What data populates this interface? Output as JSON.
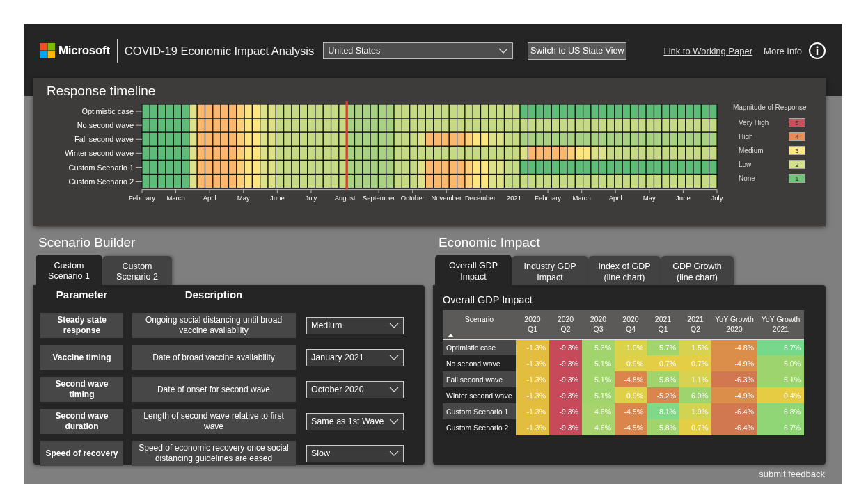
{
  "header": {
    "brand": "Microsoft",
    "title": "COVID-19 Economic Impact Analysis",
    "country": "United States",
    "state_button": "Switch to US State View",
    "paper_link": "Link to Working Paper",
    "more_info": "More Info"
  },
  "timeline": {
    "title": "Response timeline",
    "rows": [
      {
        "label": "Optimistic case",
        "cells_before_marker": [
          {
            "color": "#5fbb78"
          },
          {
            "color": "#5fbb78"
          },
          {
            "color": "#5fbb78"
          },
          {
            "color": "#5fbb78"
          },
          {
            "color": "#5fbb78"
          },
          {
            "color": "#5fbb78"
          },
          {
            "color": "#dde18a"
          },
          {
            "color": "#f9b86e"
          },
          {
            "color": "#f9b86e"
          },
          {
            "color": "#f9b86e"
          },
          {
            "color": "#f9b86e"
          },
          {
            "color": "#f9b86e"
          },
          {
            "color": "#fccf78"
          },
          {
            "color": "#fde57f"
          },
          {
            "color": "#fde57f"
          },
          {
            "color": "#dde18a"
          },
          {
            "color": "#dde18a"
          },
          {
            "color": "#c6da86"
          },
          {
            "color": "#c6da86"
          },
          {
            "color": "#c6da86"
          },
          {
            "color": "#c6da86"
          },
          {
            "color": "#c6da86"
          },
          {
            "color": "#c6da86"
          },
          {
            "color": "#c6da86"
          },
          {
            "color": "#c6da86"
          },
          {
            "color": "#c6da86"
          }
        ],
        "cells_after_marker": [
          {
            "color": "#a9d183"
          },
          {
            "color": "#a9d183"
          },
          {
            "color": "#a9d183"
          },
          {
            "color": "#a9d183"
          },
          {
            "color": "#a9d183"
          },
          {
            "color": "#a9d183"
          },
          {
            "color": "#c6da86"
          },
          {
            "color": "#c6da86"
          },
          {
            "color": "#c6da86"
          },
          {
            "color": "#c6da86"
          },
          {
            "color": "#c6da86"
          },
          {
            "color": "#c6da86"
          },
          {
            "color": "#c6da86"
          },
          {
            "color": "#c6da86"
          },
          {
            "color": "#c6da86"
          },
          {
            "color": "#c6da86"
          },
          {
            "color": "#c6da86"
          },
          {
            "color": "#c6da86"
          },
          {
            "color": "#c6da86"
          },
          {
            "color": "#c6da86"
          },
          {
            "color": "#c6da86"
          },
          {
            "color": "#c6da86"
          },
          {
            "color": "#5fbb78"
          },
          {
            "color": "#5fbb78"
          },
          {
            "color": "#5fbb78"
          },
          {
            "color": "#5fbb78"
          },
          {
            "color": "#5fbb78"
          },
          {
            "color": "#5fbb78"
          },
          {
            "color": "#5fbb78"
          },
          {
            "color": "#5fbb78"
          },
          {
            "color": "#5fbb78"
          },
          {
            "color": "#5fbb78"
          },
          {
            "color": "#5fbb78"
          },
          {
            "color": "#5fbb78"
          },
          {
            "color": "#5fbb78"
          },
          {
            "color": "#5fbb78"
          },
          {
            "color": "#5fbb78"
          },
          {
            "color": "#5fbb78"
          },
          {
            "color": "#5fbb78"
          },
          {
            "color": "#5fbb78"
          },
          {
            "color": "#5fbb78"
          },
          {
            "color": "#5fbb78"
          },
          {
            "color": "#5fbb78"
          },
          {
            "color": "#5fbb78"
          },
          {
            "color": "#5fbb78"
          },
          {
            "color": "#5fbb78"
          },
          {
            "color": "#5fbb78"
          }
        ]
      },
      {
        "label": "No second wave",
        "cells_before_marker": [
          {
            "color": "#5fbb78"
          },
          {
            "color": "#5fbb78"
          },
          {
            "color": "#5fbb78"
          },
          {
            "color": "#5fbb78"
          },
          {
            "color": "#5fbb78"
          },
          {
            "color": "#5fbb78"
          },
          {
            "color": "#dde18a"
          },
          {
            "color": "#f9b86e"
          },
          {
            "color": "#f9b86e"
          },
          {
            "color": "#f9b86e"
          },
          {
            "color": "#f9b86e"
          },
          {
            "color": "#f9b86e"
          },
          {
            "color": "#fccf78"
          },
          {
            "color": "#fde57f"
          },
          {
            "color": "#fde57f"
          },
          {
            "color": "#dde18a"
          },
          {
            "color": "#dde18a"
          },
          {
            "color": "#c6da86"
          },
          {
            "color": "#c6da86"
          },
          {
            "color": "#c6da86"
          },
          {
            "color": "#c6da86"
          },
          {
            "color": "#c6da86"
          },
          {
            "color": "#c6da86"
          },
          {
            "color": "#c6da86"
          },
          {
            "color": "#c6da86"
          },
          {
            "color": "#c6da86"
          }
        ],
        "cells_after_marker": [
          {
            "color": "#a9d183"
          },
          {
            "color": "#a9d183"
          },
          {
            "color": "#a9d183"
          },
          {
            "color": "#a9d183"
          },
          {
            "color": "#a9d183"
          },
          {
            "color": "#a9d183"
          },
          {
            "color": "#c6da86"
          },
          {
            "color": "#c6da86"
          },
          {
            "color": "#c6da86"
          },
          {
            "color": "#c6da86"
          },
          {
            "color": "#c6da86"
          },
          {
            "color": "#c6da86"
          },
          {
            "color": "#c6da86"
          },
          {
            "color": "#c6da86"
          },
          {
            "color": "#c6da86"
          },
          {
            "color": "#c6da86"
          },
          {
            "color": "#c6da86"
          },
          {
            "color": "#c6da86"
          },
          {
            "color": "#c6da86"
          },
          {
            "color": "#c6da86"
          },
          {
            "color": "#c6da86"
          },
          {
            "color": "#c6da86"
          },
          {
            "color": "#c6da86"
          },
          {
            "color": "#c6da86"
          },
          {
            "color": "#c6da86"
          },
          {
            "color": "#c6da86"
          },
          {
            "color": "#c6da86"
          },
          {
            "color": "#c6da86"
          },
          {
            "color": "#c6da86"
          },
          {
            "color": "#c6da86"
          },
          {
            "color": "#c6da86"
          },
          {
            "color": "#c6da86"
          },
          {
            "color": "#c6da86"
          },
          {
            "color": "#c6da86"
          },
          {
            "color": "#c6da86"
          },
          {
            "color": "#c6da86"
          },
          {
            "color": "#c6da86"
          },
          {
            "color": "#c6da86"
          },
          {
            "color": "#c6da86"
          },
          {
            "color": "#c6da86"
          },
          {
            "color": "#c6da86"
          },
          {
            "color": "#c6da86"
          },
          {
            "color": "#c6da86"
          },
          {
            "color": "#c6da86"
          },
          {
            "color": "#c6da86"
          },
          {
            "color": "#c6da86"
          },
          {
            "color": "#c6da86"
          }
        ]
      },
      {
        "label": "Fall second wave",
        "cells_before_marker": [
          {
            "color": "#5fbb78"
          },
          {
            "color": "#5fbb78"
          },
          {
            "color": "#5fbb78"
          },
          {
            "color": "#5fbb78"
          },
          {
            "color": "#5fbb78"
          },
          {
            "color": "#5fbb78"
          },
          {
            "color": "#dde18a"
          },
          {
            "color": "#f9b86e"
          },
          {
            "color": "#f9b86e"
          },
          {
            "color": "#f9b86e"
          },
          {
            "color": "#f9b86e"
          },
          {
            "color": "#f9b86e"
          },
          {
            "color": "#fccf78"
          },
          {
            "color": "#fde57f"
          },
          {
            "color": "#fde57f"
          },
          {
            "color": "#dde18a"
          },
          {
            "color": "#dde18a"
          },
          {
            "color": "#c6da86"
          },
          {
            "color": "#c6da86"
          },
          {
            "color": "#c6da86"
          },
          {
            "color": "#c6da86"
          },
          {
            "color": "#c6da86"
          },
          {
            "color": "#c6da86"
          },
          {
            "color": "#c6da86"
          },
          {
            "color": "#c6da86"
          },
          {
            "color": "#c6da86"
          }
        ],
        "cells_after_marker": [
          {
            "color": "#a9d183"
          },
          {
            "color": "#a9d183"
          },
          {
            "color": "#a9d183"
          },
          {
            "color": "#a9d183"
          },
          {
            "color": "#a9d183"
          },
          {
            "color": "#a9d183"
          },
          {
            "color": "#c6da86"
          },
          {
            "color": "#c6da86"
          },
          {
            "color": "#c6da86"
          },
          {
            "color": "#dde18a"
          },
          {
            "color": "#f9b86e"
          },
          {
            "color": "#f9b86e"
          },
          {
            "color": "#f9b86e"
          },
          {
            "color": "#f9b86e"
          },
          {
            "color": "#f9b86e"
          },
          {
            "color": "#fccf78"
          },
          {
            "color": "#fde57f"
          },
          {
            "color": "#fde57f"
          },
          {
            "color": "#dde18a"
          },
          {
            "color": "#dde18a"
          },
          {
            "color": "#c6da86"
          },
          {
            "color": "#c6da86"
          },
          {
            "color": "#a9d183"
          },
          {
            "color": "#a9d183"
          },
          {
            "color": "#a9d183"
          },
          {
            "color": "#a9d183"
          },
          {
            "color": "#a9d183"
          },
          {
            "color": "#a9d183"
          },
          {
            "color": "#a9d183"
          },
          {
            "color": "#a9d183"
          },
          {
            "color": "#a9d183"
          },
          {
            "color": "#a9d183"
          },
          {
            "color": "#a9d183"
          },
          {
            "color": "#a9d183"
          },
          {
            "color": "#a9d183"
          },
          {
            "color": "#a9d183"
          },
          {
            "color": "#a9d183"
          },
          {
            "color": "#a9d183"
          },
          {
            "color": "#a9d183"
          },
          {
            "color": "#a9d183"
          },
          {
            "color": "#a9d183"
          },
          {
            "color": "#a9d183"
          },
          {
            "color": "#a9d183"
          },
          {
            "color": "#a9d183"
          },
          {
            "color": "#a9d183"
          },
          {
            "color": "#a9d183"
          },
          {
            "color": "#a9d183"
          }
        ]
      },
      {
        "label": "Winter second wave",
        "cells_before_marker": [
          {
            "color": "#5fbb78"
          },
          {
            "color": "#5fbb78"
          },
          {
            "color": "#5fbb78"
          },
          {
            "color": "#5fbb78"
          },
          {
            "color": "#5fbb78"
          },
          {
            "color": "#5fbb78"
          },
          {
            "color": "#dde18a"
          },
          {
            "color": "#f9b86e"
          },
          {
            "color": "#f9b86e"
          },
          {
            "color": "#f9b86e"
          },
          {
            "color": "#f9b86e"
          },
          {
            "color": "#f9b86e"
          },
          {
            "color": "#fccf78"
          },
          {
            "color": "#fde57f"
          },
          {
            "color": "#fde57f"
          },
          {
            "color": "#dde18a"
          },
          {
            "color": "#dde18a"
          },
          {
            "color": "#c6da86"
          },
          {
            "color": "#c6da86"
          },
          {
            "color": "#c6da86"
          },
          {
            "color": "#c6da86"
          },
          {
            "color": "#c6da86"
          },
          {
            "color": "#c6da86"
          },
          {
            "color": "#c6da86"
          },
          {
            "color": "#c6da86"
          },
          {
            "color": "#c6da86"
          }
        ],
        "cells_after_marker": [
          {
            "color": "#a9d183"
          },
          {
            "color": "#a9d183"
          },
          {
            "color": "#a9d183"
          },
          {
            "color": "#a9d183"
          },
          {
            "color": "#a9d183"
          },
          {
            "color": "#a9d183"
          },
          {
            "color": "#c6da86"
          },
          {
            "color": "#c6da86"
          },
          {
            "color": "#c6da86"
          },
          {
            "color": "#c6da86"
          },
          {
            "color": "#c6da86"
          },
          {
            "color": "#c6da86"
          },
          {
            "color": "#c6da86"
          },
          {
            "color": "#c6da86"
          },
          {
            "color": "#c6da86"
          },
          {
            "color": "#c6da86"
          },
          {
            "color": "#c6da86"
          },
          {
            "color": "#c6da86"
          },
          {
            "color": "#c6da86"
          },
          {
            "color": "#c6da86"
          },
          {
            "color": "#c6da86"
          },
          {
            "color": "#c6da86"
          },
          {
            "color": "#dde18a"
          },
          {
            "color": "#f9b86e"
          },
          {
            "color": "#f9b86e"
          },
          {
            "color": "#f9b86e"
          },
          {
            "color": "#f9b86e"
          },
          {
            "color": "#f9b86e"
          },
          {
            "color": "#fccf78"
          },
          {
            "color": "#fde57f"
          },
          {
            "color": "#fde57f"
          },
          {
            "color": "#dde18a"
          },
          {
            "color": "#dde18a"
          },
          {
            "color": "#c6da86"
          },
          {
            "color": "#c6da86"
          },
          {
            "color": "#c6da86"
          },
          {
            "color": "#c6da86"
          },
          {
            "color": "#c6da86"
          },
          {
            "color": "#c6da86"
          },
          {
            "color": "#c6da86"
          },
          {
            "color": "#c6da86"
          },
          {
            "color": "#c6da86"
          },
          {
            "color": "#c6da86"
          },
          {
            "color": "#c6da86"
          },
          {
            "color": "#c6da86"
          },
          {
            "color": "#c6da86"
          },
          {
            "color": "#c6da86"
          }
        ]
      },
      {
        "label": "Custom Scenario 1",
        "cells_before_marker": [
          {
            "color": "#5fbb78"
          },
          {
            "color": "#5fbb78"
          },
          {
            "color": "#5fbb78"
          },
          {
            "color": "#5fbb78"
          },
          {
            "color": "#5fbb78"
          },
          {
            "color": "#5fbb78"
          },
          {
            "color": "#dde18a"
          },
          {
            "color": "#f9b86e"
          },
          {
            "color": "#f9b86e"
          },
          {
            "color": "#f9b86e"
          },
          {
            "color": "#f9b86e"
          },
          {
            "color": "#f9b86e"
          },
          {
            "color": "#fccf78"
          },
          {
            "color": "#fde57f"
          },
          {
            "color": "#fde57f"
          },
          {
            "color": "#dde18a"
          },
          {
            "color": "#dde18a"
          },
          {
            "color": "#c6da86"
          },
          {
            "color": "#c6da86"
          },
          {
            "color": "#c6da86"
          },
          {
            "color": "#c6da86"
          },
          {
            "color": "#c6da86"
          },
          {
            "color": "#c6da86"
          },
          {
            "color": "#c6da86"
          },
          {
            "color": "#c6da86"
          },
          {
            "color": "#c6da86"
          }
        ],
        "cells_after_marker": [
          {
            "color": "#a9d183"
          },
          {
            "color": "#a9d183"
          },
          {
            "color": "#a9d183"
          },
          {
            "color": "#a9d183"
          },
          {
            "color": "#a9d183"
          },
          {
            "color": "#a9d183"
          },
          {
            "color": "#c6da86"
          },
          {
            "color": "#c6da86"
          },
          {
            "color": "#c6da86"
          },
          {
            "color": "#dde18a"
          },
          {
            "color": "#f9b86e"
          },
          {
            "color": "#f9b86e"
          },
          {
            "color": "#f9b86e"
          },
          {
            "color": "#f9b86e"
          },
          {
            "color": "#f9b86e"
          },
          {
            "color": "#fccf78"
          },
          {
            "color": "#fde57f"
          },
          {
            "color": "#fde57f"
          },
          {
            "color": "#dde18a"
          },
          {
            "color": "#dde18a"
          },
          {
            "color": "#c6da86"
          },
          {
            "color": "#c6da86"
          },
          {
            "color": "#5fbb78"
          },
          {
            "color": "#5fbb78"
          },
          {
            "color": "#5fbb78"
          },
          {
            "color": "#5fbb78"
          },
          {
            "color": "#5fbb78"
          },
          {
            "color": "#5fbb78"
          },
          {
            "color": "#5fbb78"
          },
          {
            "color": "#5fbb78"
          },
          {
            "color": "#5fbb78"
          },
          {
            "color": "#5fbb78"
          },
          {
            "color": "#5fbb78"
          },
          {
            "color": "#5fbb78"
          },
          {
            "color": "#5fbb78"
          },
          {
            "color": "#5fbb78"
          },
          {
            "color": "#5fbb78"
          },
          {
            "color": "#5fbb78"
          },
          {
            "color": "#5fbb78"
          },
          {
            "color": "#5fbb78"
          },
          {
            "color": "#5fbb78"
          },
          {
            "color": "#5fbb78"
          },
          {
            "color": "#5fbb78"
          },
          {
            "color": "#5fbb78"
          },
          {
            "color": "#5fbb78"
          },
          {
            "color": "#5fbb78"
          },
          {
            "color": "#5fbb78"
          }
        ]
      },
      {
        "label": "Custom Scenario 2",
        "cells_before_marker": [
          {
            "color": "#5fbb78"
          },
          {
            "color": "#5fbb78"
          },
          {
            "color": "#5fbb78"
          },
          {
            "color": "#5fbb78"
          },
          {
            "color": "#5fbb78"
          },
          {
            "color": "#5fbb78"
          },
          {
            "color": "#dde18a"
          },
          {
            "color": "#f9b86e"
          },
          {
            "color": "#f9b86e"
          },
          {
            "color": "#f9b86e"
          },
          {
            "color": "#f9b86e"
          },
          {
            "color": "#f9b86e"
          },
          {
            "color": "#fccf78"
          },
          {
            "color": "#fde57f"
          },
          {
            "color": "#fde57f"
          },
          {
            "color": "#dde18a"
          },
          {
            "color": "#dde18a"
          },
          {
            "color": "#c6da86"
          },
          {
            "color": "#c6da86"
          },
          {
            "color": "#c6da86"
          },
          {
            "color": "#c6da86"
          },
          {
            "color": "#c6da86"
          },
          {
            "color": "#c6da86"
          },
          {
            "color": "#c6da86"
          },
          {
            "color": "#c6da86"
          },
          {
            "color": "#c6da86"
          }
        ],
        "cells_after_marker": [
          {
            "color": "#a9d183"
          },
          {
            "color": "#a9d183"
          },
          {
            "color": "#a9d183"
          },
          {
            "color": "#a9d183"
          },
          {
            "color": "#a9d183"
          },
          {
            "color": "#a9d183"
          },
          {
            "color": "#c6da86"
          },
          {
            "color": "#c6da86"
          },
          {
            "color": "#c6da86"
          },
          {
            "color": "#dde18a"
          },
          {
            "color": "#f9b86e"
          },
          {
            "color": "#f9b86e"
          },
          {
            "color": "#f9b86e"
          },
          {
            "color": "#f9b86e"
          },
          {
            "color": "#f9b86e"
          },
          {
            "color": "#fccf78"
          },
          {
            "color": "#fde57f"
          },
          {
            "color": "#fde57f"
          },
          {
            "color": "#dde18a"
          },
          {
            "color": "#dde18a"
          },
          {
            "color": "#c6da86"
          },
          {
            "color": "#c6da86"
          },
          {
            "color": "#c6da86"
          },
          {
            "color": "#c6da86"
          },
          {
            "color": "#c6da86"
          },
          {
            "color": "#c6da86"
          },
          {
            "color": "#c6da86"
          },
          {
            "color": "#c6da86"
          },
          {
            "color": "#c6da86"
          },
          {
            "color": "#c6da86"
          },
          {
            "color": "#c6da86"
          },
          {
            "color": "#c6da86"
          },
          {
            "color": "#c6da86"
          },
          {
            "color": "#c6da86"
          },
          {
            "color": "#c6da86"
          },
          {
            "color": "#c6da86"
          },
          {
            "color": "#c6da86"
          },
          {
            "color": "#c6da86"
          },
          {
            "color": "#c6da86"
          },
          {
            "color": "#c6da86"
          },
          {
            "color": "#c6da86"
          },
          {
            "color": "#c6da86"
          },
          {
            "color": "#c6da86"
          },
          {
            "color": "#c6da86"
          },
          {
            "color": "#c6da86"
          },
          {
            "color": "#c6da86"
          },
          {
            "color": "#c6da86"
          }
        ]
      }
    ],
    "months": [
      "February",
      "March",
      "April",
      "May",
      "June",
      "July",
      "August",
      "September",
      "October",
      "November",
      "December",
      "2021",
      "February",
      "March",
      "April",
      "May",
      "June",
      "July"
    ],
    "legend": {
      "title": "Magnitude of Response",
      "items": [
        {
          "label": "Very High",
          "value": "5",
          "color": "#c9505a"
        },
        {
          "label": "High",
          "value": "4",
          "color": "#e98b56"
        },
        {
          "label": "Medium",
          "value": "3",
          "color": "#fde883"
        },
        {
          "label": "Low",
          "value": "2",
          "color": "#d2e18a"
        },
        {
          "label": "None",
          "value": "1",
          "color": "#6dc47a"
        }
      ]
    }
  },
  "scenario_builder": {
    "title": "Scenario Builder",
    "tabs": [
      {
        "label": "Custom Scenario 1",
        "selected": true
      },
      {
        "label": "Custom Scenario 2",
        "selected": false
      }
    ],
    "columns": [
      "Parameter",
      "Description"
    ],
    "rows": [
      {
        "parameter": "Steady state response",
        "description": "Ongoing social distancing until broad vaccine availability",
        "value": "Medium"
      },
      {
        "parameter": "Vaccine timing",
        "description": "Date of broad vaccine availability",
        "value": "January 2021"
      },
      {
        "parameter": "Second wave timing",
        "description": "Date of onset for second wave",
        "value": "October 2020"
      },
      {
        "parameter": "Second wave duration",
        "description": "Length of second wave relative to first wave",
        "value": "Same as 1st Wave"
      },
      {
        "parameter": "Speed of recovery",
        "description": "Speed of economic recovery once social distancing guidelines are eased",
        "value": "Slow"
      }
    ]
  },
  "economic_impact": {
    "title": "Economic Impact",
    "tabs": [
      {
        "label": "Overall GDP Impact",
        "selected": true
      },
      {
        "label": "Industry GDP Impact",
        "selected": false
      },
      {
        "label": "Index of GDP (line chart)",
        "selected": false
      },
      {
        "label": "GDP Growth (line chart)",
        "selected": false
      }
    ],
    "table": {
      "title": "Overall GDP Impact",
      "columns": [
        "Scenario",
        "2020 Q1",
        "2020 Q2",
        "2020 Q3",
        "2020 Q4",
        "2021 Q1",
        "2021 Q2",
        "YoY Growth 2020",
        "YoY Growth 2021"
      ],
      "rows": [
        {
          "scenario": "Optimistic case",
          "values": [
            {
              "text": "-1.3%",
              "color": "#e3bd3f"
            },
            {
              "text": "-9.3%",
              "color": "#c64a5a"
            },
            {
              "text": "5.3%",
              "color": "#a2d46e"
            },
            {
              "text": "1.0%",
              "color": "#dbd24c"
            },
            {
              "text": "5.7%",
              "color": "#a2d46e"
            },
            {
              "text": "1.5%",
              "color": "#d7d24f"
            },
            {
              "text": "-4.8%",
              "color": "#db8e4a"
            },
            {
              "text": "8.7%",
              "color": "#76d88a"
            }
          ]
        },
        {
          "scenario": "No second wave",
          "values": [
            {
              "text": "-1.3%",
              "color": "#e3bd3f"
            },
            {
              "text": "-9.3%",
              "color": "#c64a5a"
            },
            {
              "text": "5.1%",
              "color": "#a2d46e"
            },
            {
              "text": "0.9%",
              "color": "#dfd049"
            },
            {
              "text": "0.7%",
              "color": "#e4ce45"
            },
            {
              "text": "0.7%",
              "color": "#e4ce45"
            },
            {
              "text": "-4.9%",
              "color": "#db8e4a"
            },
            {
              "text": "5.0%",
              "color": "#9ed46d"
            }
          ]
        },
        {
          "scenario": "Fall second wave",
          "values": [
            {
              "text": "-1.3%",
              "color": "#e3bd3f"
            },
            {
              "text": "-9.3%",
              "color": "#c64a5a"
            },
            {
              "text": "5.1%",
              "color": "#a2d46e"
            },
            {
              "text": "-4.8%",
              "color": "#d9854c"
            },
            {
              "text": "5.8%",
              "color": "#a2d46e"
            },
            {
              "text": "1.1%",
              "color": "#d7d24f"
            },
            {
              "text": "-6.3%",
              "color": "#d27850"
            },
            {
              "text": "5.1%",
              "color": "#9ed46d"
            }
          ]
        },
        {
          "scenario": "Winter second wave",
          "values": [
            {
              "text": "-1.3%",
              "color": "#e3bd3f"
            },
            {
              "text": "-9.3%",
              "color": "#c64a5a"
            },
            {
              "text": "5.1%",
              "color": "#a2d46e"
            },
            {
              "text": "0.9%",
              "color": "#dfd049"
            },
            {
              "text": "-5.2%",
              "color": "#d9854c"
            },
            {
              "text": "6.0%",
              "color": "#9ed46d"
            },
            {
              "text": "-4.9%",
              "color": "#db8e4a"
            },
            {
              "text": "0.4%",
              "color": "#e6cc42"
            }
          ]
        },
        {
          "scenario": "Custom Scenario 1",
          "values": [
            {
              "text": "-1.3%",
              "color": "#e3bd3f"
            },
            {
              "text": "-9.3%",
              "color": "#c64a5a"
            },
            {
              "text": "4.6%",
              "color": "#a8d46e"
            },
            {
              "text": "-4.5%",
              "color": "#d9854c"
            },
            {
              "text": "8.1%",
              "color": "#80d986"
            },
            {
              "text": "1.9%",
              "color": "#d2d451"
            },
            {
              "text": "-6.4%",
              "color": "#d27850"
            },
            {
              "text": "6.8%",
              "color": "#90d576"
            }
          ]
        },
        {
          "scenario": "Custom Scenario 2",
          "values": [
            {
              "text": "-1.3%",
              "color": "#e3bd3f"
            },
            {
              "text": "-9.3%",
              "color": "#c64a5a"
            },
            {
              "text": "4.6%",
              "color": "#a8d46e"
            },
            {
              "text": "-4.5%",
              "color": "#d9854c"
            },
            {
              "text": "5.8%",
              "color": "#a2d46e"
            },
            {
              "text": "0.7%",
              "color": "#e4ce45"
            },
            {
              "text": "-6.4%",
              "color": "#d27850"
            },
            {
              "text": "6.7%",
              "color": "#90d576"
            }
          ]
        }
      ]
    }
  },
  "footer": {
    "feedback_link": "submit feedback"
  }
}
